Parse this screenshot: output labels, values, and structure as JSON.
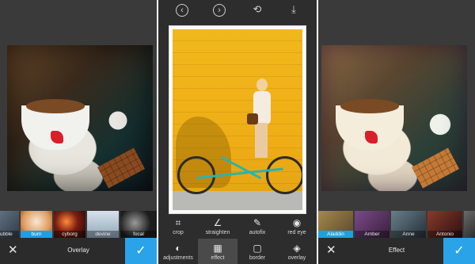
{
  "left_panel": {
    "filters": [
      "bubble",
      "burn",
      "cyborg",
      "devine",
      "focal"
    ],
    "selected_filter": "burn",
    "bottom_title": "Overlay",
    "cancel_icon": "close-icon",
    "confirm_icon": "check-icon"
  },
  "middle_panel": {
    "topbar_icons": [
      "undo-icon",
      "redo-icon",
      "compare-icon",
      "download-icon"
    ],
    "tools_row1": [
      {
        "label": "crop",
        "icon": "crop-icon"
      },
      {
        "label": "straighten",
        "icon": "straighten-icon"
      },
      {
        "label": "autofix",
        "icon": "autofix-icon"
      },
      {
        "label": "red eye",
        "icon": "eye-icon"
      }
    ],
    "tools_row2": [
      {
        "label": "adjustments",
        "icon": "adjust-icon"
      },
      {
        "label": "effect",
        "icon": "film-icon",
        "active": true
      },
      {
        "label": "border",
        "icon": "border-icon"
      },
      {
        "label": "overlay",
        "icon": "layers-icon"
      }
    ]
  },
  "right_panel": {
    "filters": [
      "Aladdin",
      "Amber",
      "Anne",
      "Antonio"
    ],
    "selected_filter": "Aladdin",
    "bottom_title": "Effect",
    "cancel_icon": "close-icon",
    "confirm_icon": "check-icon"
  },
  "colors": {
    "accent": "#2aa3e8",
    "selected_label": "#1ba1e2",
    "toolbar_bg": "#2b2b2b"
  }
}
